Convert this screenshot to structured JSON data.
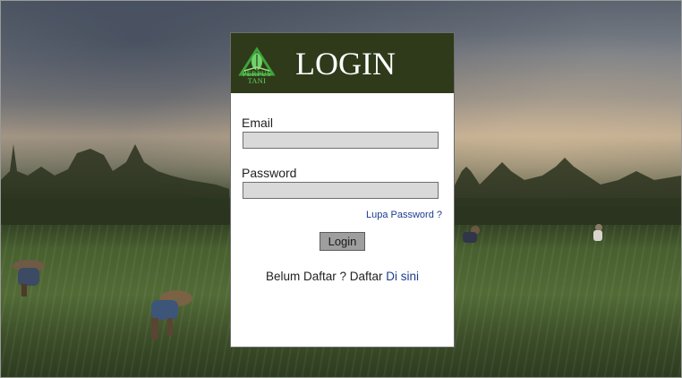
{
  "header": {
    "logo_text_line1": "PERPUS",
    "logo_text_line2": "TANI",
    "title": "LOGIN"
  },
  "form": {
    "email_label": "Email",
    "email_value": "",
    "password_label": "Password",
    "password_value": "",
    "forgot_link": "Lupa Password ?",
    "login_button": "Login",
    "register_prefix": "Belum Daftar ? Daftar",
    "register_link": "Di sini"
  },
  "colors": {
    "header_bg": "#2e3a1a",
    "logo_green": "#6fd36a",
    "link_blue": "#1b3d8f",
    "input_bg": "#d9d9d9",
    "button_bg": "#9e9e9e"
  },
  "icons": {
    "logo": "leaf-book-logo-icon"
  }
}
